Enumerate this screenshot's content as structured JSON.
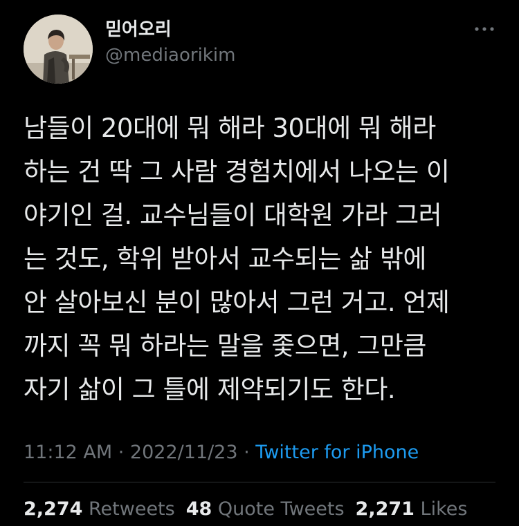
{
  "author": {
    "display_name": "믿어오리",
    "username": "@mediaorikim"
  },
  "tweet": {
    "lines": [
      "남들이 20대에 뭐 해라 30대에 뭐 해라",
      "하는 건 딱 그 사람 경험치에서 나오는 이",
      "야기인 걸. 교수님들이 대학원 가라 그러",
      "는 것도, 학위 받아서 교수되는 삶 밖에",
      "안 살아보신 분이 많아서 그런 거고. 언제",
      "까지 꼭 뭐 하라는 말을 좇으면, 그만큼",
      "자기 삶이 그 틀에 제약되기도 한다."
    ],
    "time": "11:12 AM",
    "separator": " · ",
    "date": "2022/11/23",
    "source": "Twitter for iPhone"
  },
  "stats": {
    "retweets_count": "2,274",
    "retweets_label": "Retweets",
    "quotes_count": "48",
    "quotes_label": "Quote Tweets",
    "likes_count": "2,271",
    "likes_label": "Likes"
  },
  "icons": {
    "more": "more-horizontal-icon"
  },
  "colors": {
    "background": "#000000",
    "primary_text": "#e7e9ea",
    "secondary_text": "#71767b",
    "accent": "#1d9bf0",
    "divider": "#2f3336"
  }
}
